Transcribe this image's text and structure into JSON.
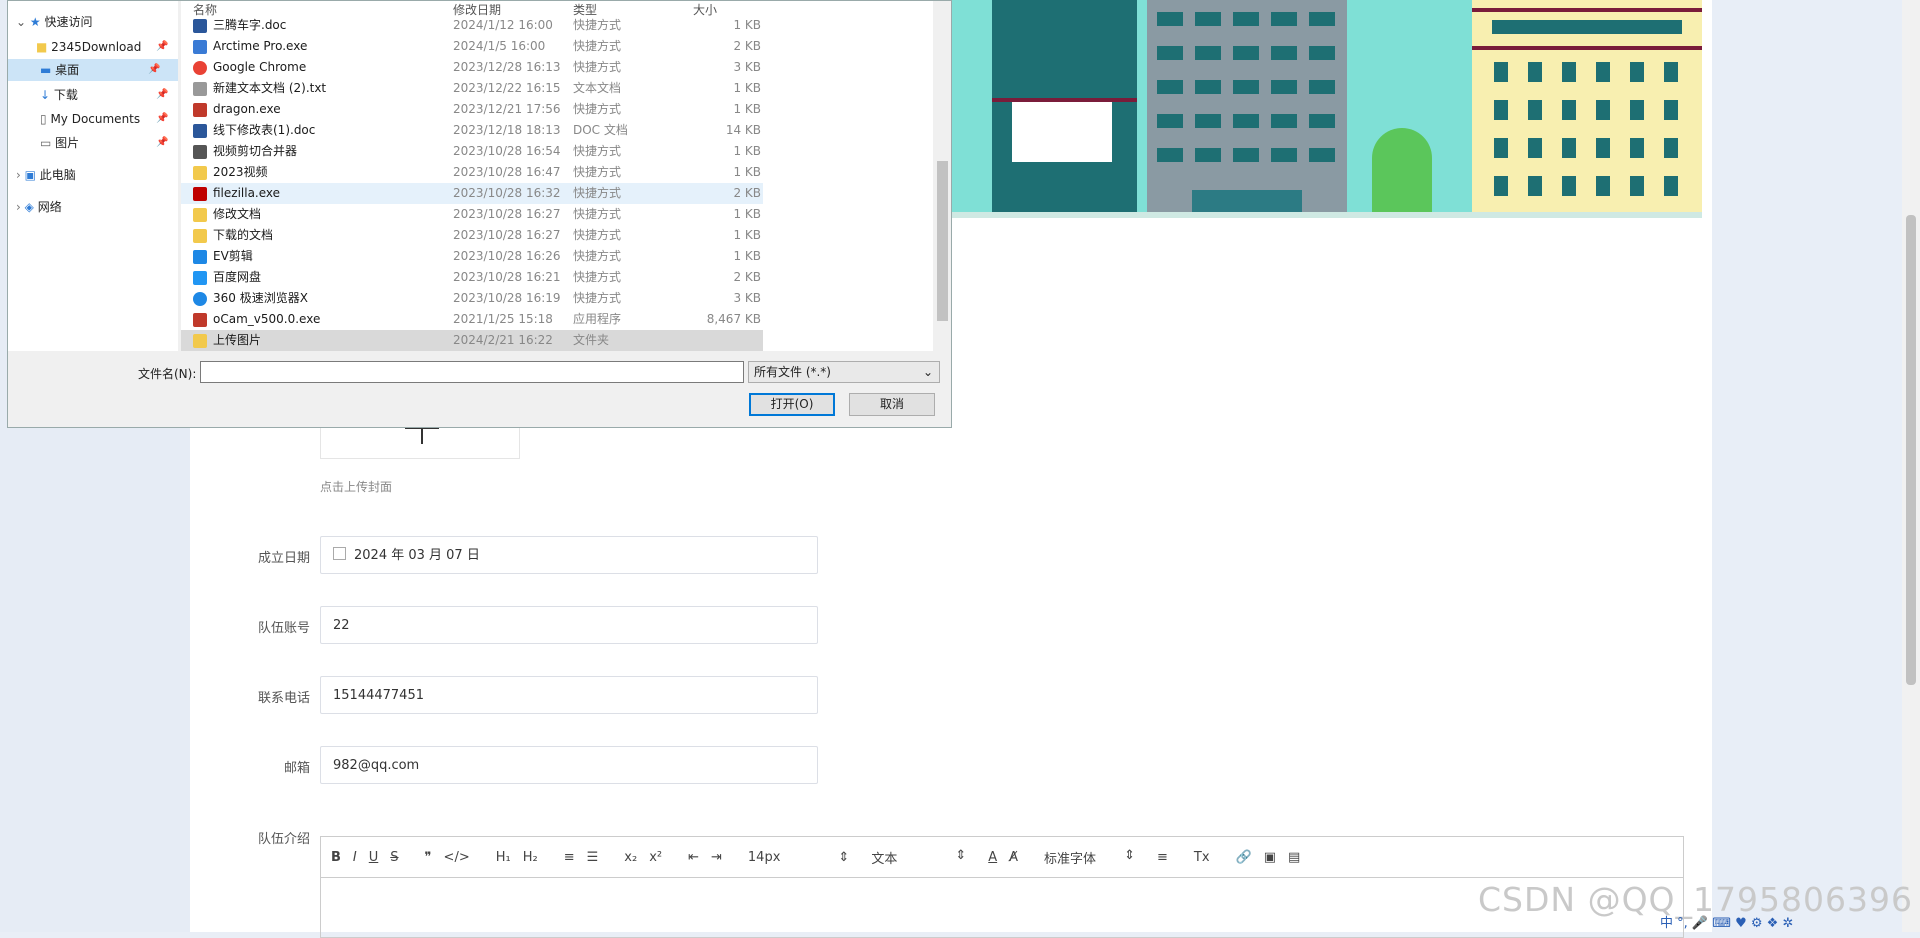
{
  "dialog": {
    "nav": {
      "quick_access": "快速访问",
      "items": [
        {
          "label": "2345Download"
        },
        {
          "label": "桌面"
        },
        {
          "label": "下载"
        },
        {
          "label": "My Documents"
        },
        {
          "label": "图片"
        }
      ],
      "this_pc": "此电脑",
      "network": "网络"
    },
    "columns": {
      "name": "名称",
      "date": "修改日期",
      "type": "类型",
      "size": "大小"
    },
    "files": [
      {
        "name": "三腾车字.doc",
        "date": "2024/1/12 16:00",
        "type": "快捷方式",
        "size": "1 KB",
        "icon": "doc-icon"
      },
      {
        "name": "Arctime Pro.exe",
        "date": "2024/1/5 16:00",
        "type": "快捷方式",
        "size": "2 KB",
        "icon": "arctime-icon"
      },
      {
        "name": "Google Chrome",
        "date": "2023/12/28 16:13",
        "type": "快捷方式",
        "size": "3 KB",
        "icon": "chrome-icon"
      },
      {
        "name": "新建文本文档 (2).txt",
        "date": "2023/12/22 16:15",
        "type": "文本文档",
        "size": "1 KB",
        "icon": "txt-icon"
      },
      {
        "name": "dragon.exe",
        "date": "2023/12/21 17:56",
        "type": "快捷方式",
        "size": "1 KB",
        "icon": "dragon-icon"
      },
      {
        "name": "线下修改表(1).doc",
        "date": "2023/12/18 18:13",
        "type": "DOC 文档",
        "size": "14 KB",
        "icon": "doc-icon"
      },
      {
        "name": "视频剪切合并器",
        "date": "2023/10/28 16:54",
        "type": "快捷方式",
        "size": "1 KB",
        "icon": "video-icon"
      },
      {
        "name": "2023视频",
        "date": "2023/10/28 16:47",
        "type": "快捷方式",
        "size": "1 KB",
        "icon": "folder-shortcut-icon"
      },
      {
        "name": "filezilla.exe",
        "date": "2023/10/28 16:32",
        "type": "快捷方式",
        "size": "2 KB",
        "icon": "filezilla-icon"
      },
      {
        "name": "修改文档",
        "date": "2023/10/28 16:27",
        "type": "快捷方式",
        "size": "1 KB",
        "icon": "folder-shortcut-icon"
      },
      {
        "name": "下载的文档",
        "date": "2023/10/28 16:27",
        "type": "快捷方式",
        "size": "1 KB",
        "icon": "folder-shortcut-icon"
      },
      {
        "name": "EV剪辑",
        "date": "2023/10/28 16:26",
        "type": "快捷方式",
        "size": "1 KB",
        "icon": "ev-icon"
      },
      {
        "name": "百度网盘",
        "date": "2023/10/28 16:21",
        "type": "快捷方式",
        "size": "2 KB",
        "icon": "baidu-icon"
      },
      {
        "name": "360 极速浏览器X",
        "date": "2023/10/28 16:19",
        "type": "快捷方式",
        "size": "3 KB",
        "icon": "browser-icon"
      },
      {
        "name": "oCam_v500.0.exe",
        "date": "2021/1/25 15:18",
        "type": "应用程序",
        "size": "8,467 KB",
        "icon": "exe-icon"
      },
      {
        "name": "上传图片",
        "date": "2024/2/21 16:22",
        "type": "文件夹",
        "size": "",
        "icon": "folder-icon"
      }
    ],
    "filename_label": "文件名(N):",
    "filename_value": "",
    "filetype_value": "所有文件 (*.*)",
    "open_button": "打开(O)",
    "cancel_button": "取消"
  },
  "form": {
    "cover_hint": "点击上传封面",
    "fields": [
      {
        "label": "成立日期",
        "value": "2024 年 03 月 07 日"
      },
      {
        "label": "队伍账号",
        "value": "22"
      },
      {
        "label": "联系电话",
        "value": "15144477451"
      },
      {
        "label": "邮箱",
        "value": "982@qq.com"
      }
    ],
    "intro_label": "队伍介绍",
    "toolbar": {
      "bold": "B",
      "italic": "I",
      "underline": "U",
      "strike": "S",
      "quote": "❞",
      "code": "</>",
      "h1": "H₁",
      "h2": "H₂",
      "ol": "≡",
      "ul": "☰",
      "sub": "x₂",
      "sup": "x²",
      "outdent": "⇤",
      "indent": "⇥",
      "size": "14px",
      "paragraph": "文本",
      "font_color": "A",
      "bg_color": "A̸",
      "font": "标准字体",
      "align": "≡",
      "clear": "Tx",
      "link": "🔗",
      "image": "▣",
      "video": "▤",
      "arrows": "⇕"
    }
  },
  "watermark": "CSDN @QQ_1795806396",
  "tray": "中 °, 🎤 ⌨ ♥ ⚙ ❖ ✲"
}
